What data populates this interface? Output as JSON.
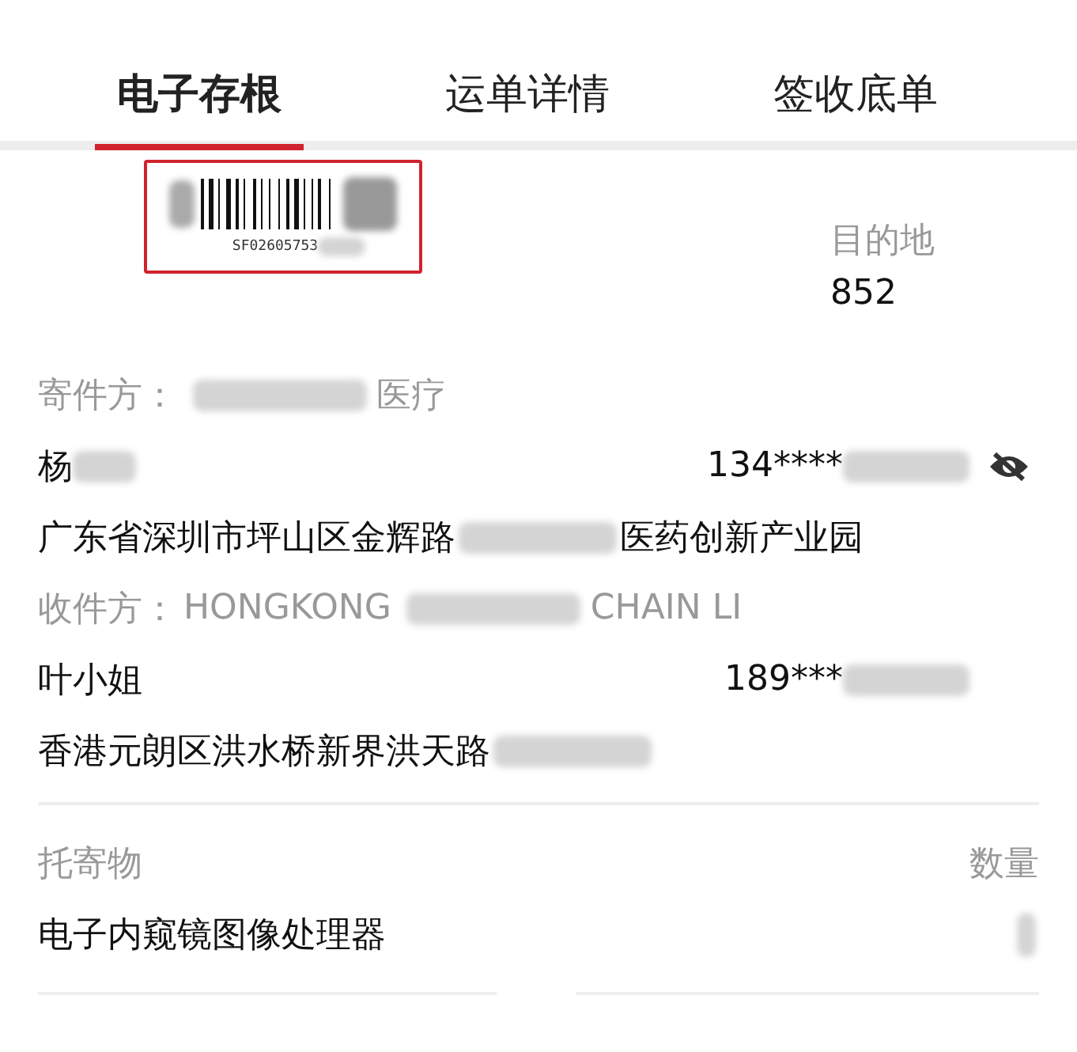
{
  "tabs": [
    {
      "label": "电子存根",
      "selected": true
    },
    {
      "label": "运单详情",
      "selected": false
    },
    {
      "label": "签收底单",
      "selected": false
    }
  ],
  "waybill": {
    "number": "SF02605753"
  },
  "destination": {
    "label": "目的地",
    "value": "852"
  },
  "sender": {
    "line": [
      {
        "kind": "label",
        "text": "寄件方："
      },
      {
        "kind": "blur"
      },
      {
        "kind": "label",
        "text": "医疗"
      }
    ],
    "name": [
      {
        "kind": "text",
        "text": "杨"
      },
      {
        "kind": "blur"
      }
    ],
    "phone": [
      {
        "kind": "text",
        "text": "134****"
      },
      {
        "kind": "blur"
      }
    ],
    "phone_hidden": true,
    "address": [
      {
        "kind": "text",
        "text": "广东省深圳市坪山区金辉路"
      },
      {
        "kind": "blur"
      },
      {
        "kind": "text",
        "text": "医药创新产业园"
      }
    ]
  },
  "receiver": {
    "line": [
      {
        "kind": "label",
        "text": "收件方："
      },
      {
        "kind": "label",
        "text": "HONGKONG"
      },
      {
        "kind": "blur"
      },
      {
        "kind": "label",
        "text": "CHAIN LI"
      }
    ],
    "name": [
      {
        "kind": "text",
        "text": "叶小姐"
      }
    ],
    "phone": [
      {
        "kind": "text",
        "text": "189***"
      },
      {
        "kind": "blur"
      }
    ],
    "phone_hidden": false,
    "address": [
      {
        "kind": "text",
        "text": "香港元朗区洪水桥新界洪天路"
      },
      {
        "kind": "blur"
      }
    ]
  },
  "goods": {
    "label": "托寄物",
    "quantity_label": "数量",
    "item": "电子内窥镜图像处理器"
  }
}
